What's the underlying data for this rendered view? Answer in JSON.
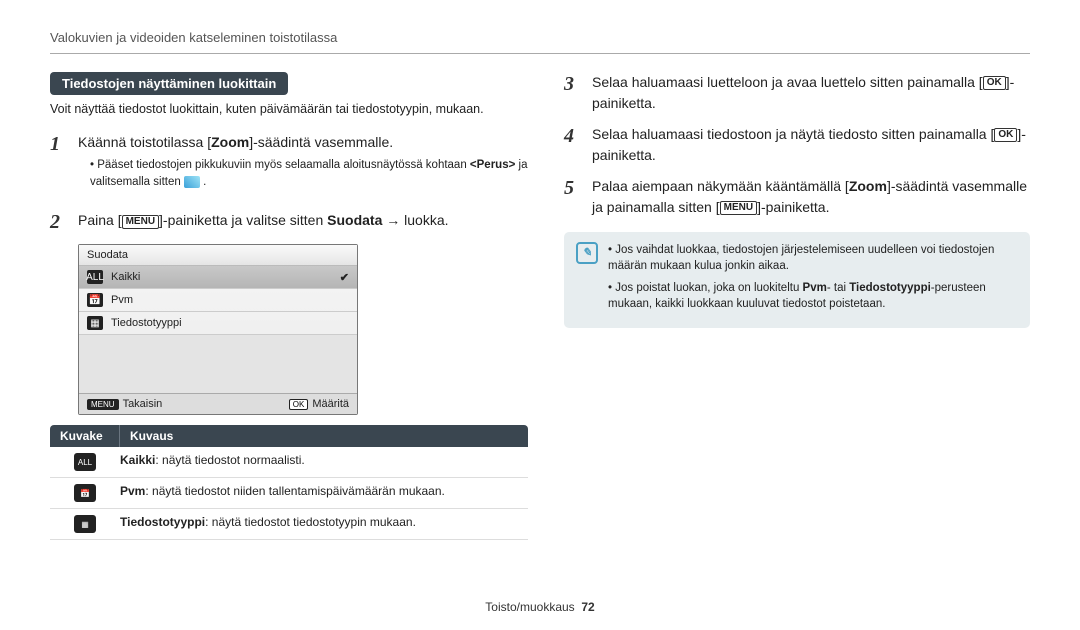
{
  "header": "Valokuvien ja videoiden katseleminen toistotilassa",
  "section_title": "Tiedostojen näyttäminen luokittain",
  "intro": "Voit näyttää tiedostot luokittain, kuten päivämäärän tai tiedostotyypin, mukaan.",
  "step1_num": "1",
  "step1_pre": "Käännä toistotilassa [",
  "step1_zoom": "Zoom",
  "step1_post": "]-säädintä vasemmalle.",
  "step1_bullet_a": "Pääset tiedostojen pikkukuviin myös selaamalla aloitusnäytössä kohtaan ",
  "step1_bullet_b": "<Perus>",
  "step1_bullet_c": " ja valitsemalla sitten ",
  "step2_num": "2",
  "step2_a": "Paina [",
  "step2_menu": "MENU",
  "step2_b": "]-painiketta ja valitse sitten ",
  "step2_suodata": "Suodata",
  "step2_c": " → luokka.",
  "mock": {
    "title": "Suodata",
    "r1": "Kaikki",
    "r2": "Pvm",
    "r3": "Tiedostotyyppi",
    "back_chip": "MENU",
    "back": "Takaisin",
    "ok_chip": "OK",
    "set": "Määritä",
    "tick": "c"
  },
  "table": {
    "h1": "Kuvake",
    "h2": "Kuvaus",
    "r1_label": "Kaikki",
    "r1_text": ": näytä tiedostot normaalisti.",
    "r2_label": "Pvm",
    "r2_text": ": näytä tiedostot niiden tallentamispäivämäärän mukaan.",
    "r3_label": "Tiedostotyyppi",
    "r3_text": ": näytä tiedostot tiedostotyypin mukaan."
  },
  "right": {
    "s3_num": "3",
    "s3_a": "Selaa haluamaasi luetteloon ja avaa luettelo sitten painamalla [",
    "s3_ok": "OK",
    "s3_b": "]-painiketta.",
    "s4_num": "4",
    "s4_a": "Selaa haluamaasi tiedostoon ja näytä tiedosto sitten painamalla [",
    "s4_ok": "OK",
    "s4_b": "]-painiketta.",
    "s5_num": "5",
    "s5_a": "Palaa aiempaan näkymään kääntämällä [",
    "s5_zoom": "Zoom",
    "s5_b": "]-säädintä vasemmalle ja painamalla sitten [",
    "s5_menu": "MENU",
    "s5_c": "]-painiketta.",
    "note1": "Jos vaihdat luokkaa, tiedostojen järjestelemiseen uudelleen voi tiedostojen määrän mukaan kulua jonkin aikaa.",
    "note2_a": "Jos poistat luokan, joka on luokiteltu ",
    "note2_b": "Pvm",
    "note2_c": "- tai ",
    "note2_d": "Tiedostotyyppi",
    "note2_e": "-perusteen mukaan, kaikki luokkaan kuuluvat tiedostot poistetaan."
  },
  "footer_label": "Toisto/muokkaus",
  "footer_page": "72"
}
